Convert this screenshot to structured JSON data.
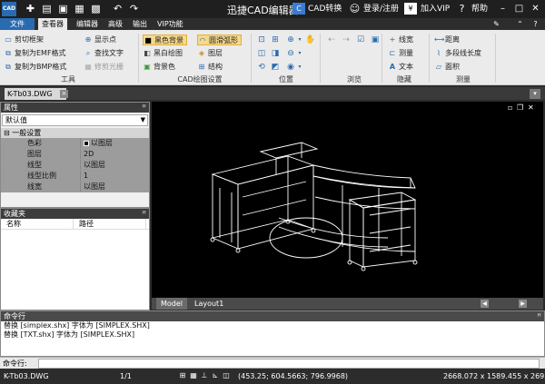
{
  "titlebar": {
    "app_logo": "CAD",
    "title": "迅捷CAD编辑器",
    "cad_convert": "CAD转换",
    "login": "登录/注册",
    "vip": "加入VIP",
    "help": "帮助",
    "vip_icon": "¥",
    "cad_icon": "C"
  },
  "menu": {
    "file": "文件",
    "tabs": [
      "查看器",
      "编辑器",
      "高级",
      "输出",
      "VIP功能"
    ]
  },
  "ribbon": {
    "tools": {
      "items": [
        "剪切框架",
        "复制为EMF格式",
        "复制为BMP格式",
        "显示点",
        "查找文字",
        "修剪光栅"
      ],
      "label": "工具"
    },
    "cad_settings": {
      "items": [
        "黑色背景",
        "圆滑弧形",
        "黑白绘图",
        "图层",
        "背景色",
        "结构"
      ],
      "label": "CAD绘图设置"
    },
    "position": {
      "label": "位置"
    },
    "browse": {
      "label": "浏览"
    },
    "hide": {
      "items": [
        "线宽",
        "测量",
        "文本"
      ],
      "label": "隐藏"
    },
    "measure": {
      "items": [
        "距离",
        "多段线长度",
        "面积"
      ],
      "label": "测量"
    }
  },
  "doc_tab": {
    "name": "K-Tb03.DWG",
    "close": "×"
  },
  "properties": {
    "title": "属性",
    "pin": "ꟸ",
    "selector": "默认值",
    "section": "一般设置",
    "rows": [
      {
        "key": "色彩",
        "value": "以图层"
      },
      {
        "key": "图层",
        "value": "2D"
      },
      {
        "key": "线型",
        "value": "以图层"
      },
      {
        "key": "线型比例",
        "value": "1"
      },
      {
        "key": "线宽",
        "value": "以图层"
      }
    ]
  },
  "favorites": {
    "title": "收藏夹",
    "pin": "ꟸ",
    "columns": [
      "名称",
      "路径"
    ]
  },
  "layout_tabs": [
    "Model",
    "Layout1"
  ],
  "command": {
    "title": "命令行",
    "pin": "ꟸ",
    "lines": [
      "替换 [simplex.shx] 字体为 [SIMPLEX.SHX]",
      "替换 [TXT.shx] 字体为 [SIMPLEX.SHX]"
    ],
    "input_label": "命令行:",
    "input_value": ""
  },
  "status": {
    "file": "K-Tb03.DWG",
    "page": "1/1",
    "coords": "(453.25; 604.5663; 796.9968)",
    "size": "2668.072 x 1589.455 x 2695.19..."
  }
}
